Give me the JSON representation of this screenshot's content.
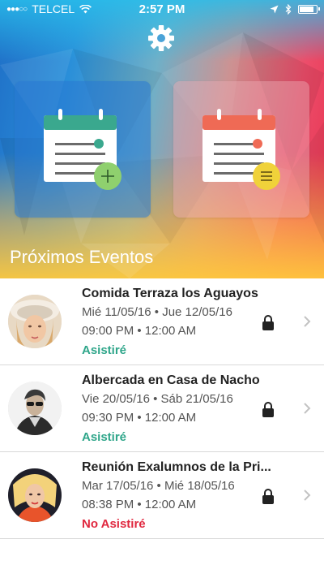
{
  "status_bar": {
    "carrier": "TELCEL",
    "time": "2:57 PM",
    "signal_dots": "●●●○○",
    "battery_level": 0.9
  },
  "header": {
    "settings_icon": "gear-icon"
  },
  "cards": [
    {
      "name": "add-event",
      "accent": "#3aa88e",
      "badge_color": "#8fd06e",
      "badge_icon": "plus-icon"
    },
    {
      "name": "event-list",
      "accent": "#ef6a55",
      "badge_color": "#f0d23a",
      "badge_icon": "menu-icon"
    }
  ],
  "section": {
    "title": "Próximos Eventos"
  },
  "colors": {
    "attending": "#2fa68a",
    "not_attending": "#e0283f"
  },
  "events": [
    {
      "title": "Comida Terraza los Aguayos",
      "dates": "Mié 11/05/16 • Jue 12/05/16",
      "times": "09:00 PM • 12:00 AM",
      "status": "Asistiré",
      "status_color": "#2fa68a"
    },
    {
      "title": "Albercada en Casa de Nacho",
      "dates": "Vie 20/05/16 • Sáb 21/05/16",
      "times": "09:30 PM • 12:00 AM",
      "status": "Asistiré",
      "status_color": "#2fa68a"
    },
    {
      "title": "Reunión Exalumnos de la Pri...",
      "dates": "Mar 17/05/16 • Mié 18/05/16",
      "times": "08:38 PM • 12:00 AM",
      "status": "No Asistiré",
      "status_color": "#e0283f"
    }
  ]
}
